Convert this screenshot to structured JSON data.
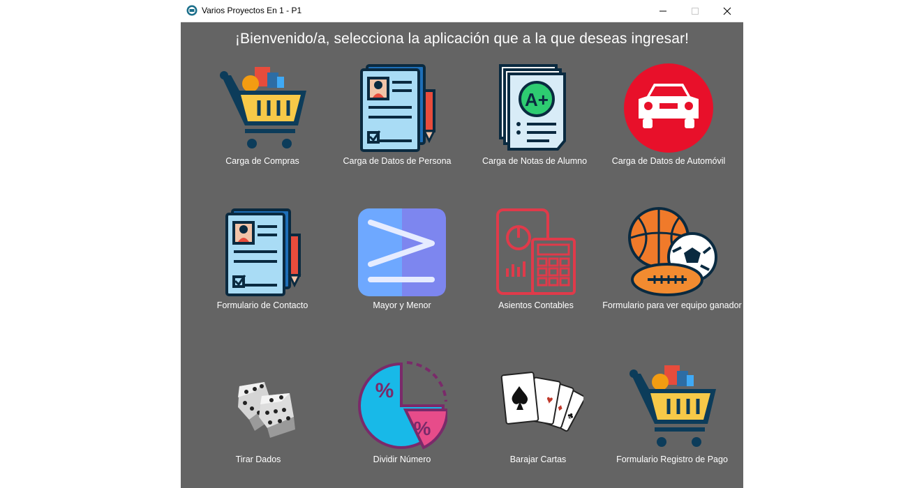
{
  "window": {
    "title": "Varios Proyectos En 1 - P1",
    "controls": {
      "minimize": "minimize",
      "maximize": "maximize",
      "close": "close"
    }
  },
  "heading": "¡Bienvenido/a, selecciona la aplicación que a la que deseas ingresar!",
  "apps": [
    {
      "label": "Carga de Compras",
      "icon": "shopping-cart-icon"
    },
    {
      "label": "Carga de Datos de Persona",
      "icon": "person-document-icon"
    },
    {
      "label": "Carga de Notas de Alumno",
      "icon": "grade-document-icon"
    },
    {
      "label": "Carga de Datos de Automóvil",
      "icon": "car-icon"
    },
    {
      "label": "Formulario de Contacto",
      "icon": "contact-form-icon"
    },
    {
      "label": "Mayor y Menor",
      "icon": "greater-equal-icon"
    },
    {
      "label": "Asientos Contables",
      "icon": "calculator-chart-icon"
    },
    {
      "label": "Formulario para ver equipo ganador",
      "icon": "sports-balls-icon"
    },
    {
      "label": "Tirar Dados",
      "icon": "dice-icon"
    },
    {
      "label": "Dividir Número",
      "icon": "percent-pie-icon"
    },
    {
      "label": "Barajar Cartas",
      "icon": "playing-cards-icon"
    },
    {
      "label": "Formulario Registro de Pago",
      "icon": "payment-cart-icon"
    }
  ],
  "colors": {
    "background": "#646464",
    "text": "#ffffff",
    "titlebar": "#ffffff"
  }
}
